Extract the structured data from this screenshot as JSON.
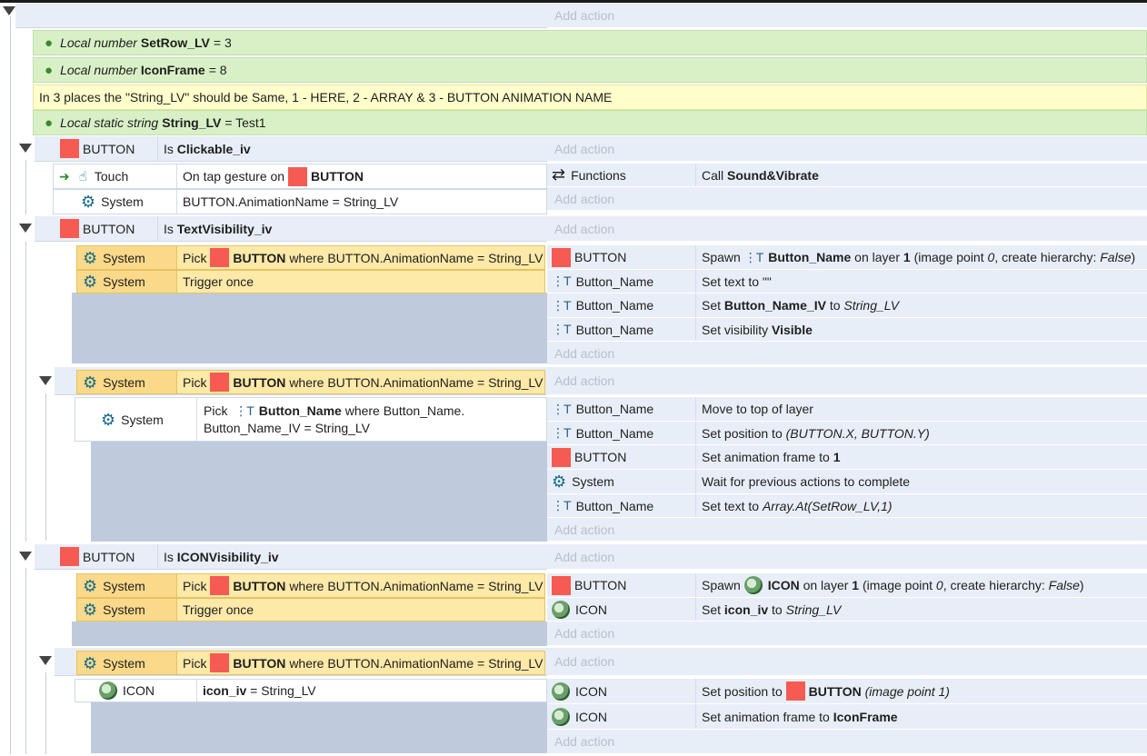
{
  "add_action": "Add action",
  "icons": {
    "tree_toggle": "expanded-triangle-icon",
    "variable": "map-pin-icon",
    "system": "gear-icon",
    "touch": "touch-hand-icon",
    "functions": "swap-arrows-icon",
    "text_object": "text-object-icon",
    "sprite": "red-square-sprite-icon",
    "icon_object": "icon-sprite-image"
  },
  "colors": {
    "variable_bg": "#d9f0c7",
    "comment_bg": "#ffffcc",
    "selected_bg": "#fde9a8",
    "sprite_red": "#f55b52",
    "block_bg": "#e8eef7",
    "panel_bg": "#bfcbdd"
  },
  "variables": [
    {
      "kind": "Local number",
      "name": "SetRow_LV",
      "eq": "= 3"
    },
    {
      "kind": "Local number",
      "name": "IconFrame",
      "eq": "= 8"
    },
    {
      "kind": "Local static string",
      "name": "String_LV",
      "eq": "= Test1"
    }
  ],
  "comment": "In 3 places the \"String_LV\" should be Same, 1 - HERE, 2 - ARRAY & 3 - BUTTON ANIMATION NAME",
  "g1": {
    "obj": "BUTTON",
    "cond_pre": "Is",
    "cond_bold": "Clickable_iv",
    "touch": {
      "obj": "Touch",
      "pre": "On tap gesture on",
      "target": "BUTTON"
    },
    "system": {
      "obj": "System",
      "text": "BUTTON.AnimationName = String_LV"
    },
    "action": {
      "obj": "Functions",
      "pre": "Call",
      "bold": "Sound&Vibrate"
    }
  },
  "g2": {
    "obj": "BUTTON",
    "cond_pre": "Is",
    "cond_bold": "TextVisibility_iv",
    "pick": {
      "obj": "System",
      "pre": "Pick",
      "target": "BUTTON",
      "rest": "where BUTTON.AnimationName = String_LV"
    },
    "trigger": {
      "obj": "System",
      "text": "Trigger once"
    },
    "actions": [
      {
        "obj": "BUTTON",
        "pre": "Spawn",
        "bold1": "Button_Name",
        "mid": "on layer",
        "bold2": "1",
        "p1": "(image point",
        "i1": "0",
        "p2": ", create hierarchy:",
        "i2": "False",
        "p3": ")"
      },
      {
        "obj": "Button_Name",
        "text": "Set text to \"\""
      },
      {
        "obj": "Button_Name",
        "pre": "Set",
        "bold": "Button_Name_IV",
        "mid": "to",
        "ital": "String_LV"
      },
      {
        "obj": "Button_Name",
        "pre": "Set visibility",
        "bold": "Visible"
      }
    ]
  },
  "g3": {
    "pick": {
      "obj": "System",
      "pre": "Pick",
      "target": "BUTTON",
      "rest": "where BUTTON.AnimationName = String_LV"
    },
    "sub": {
      "obj": "System",
      "pre": "Pick",
      "bold": "Button_Name",
      "rest": "where Button_Name.",
      "line2": "Button_Name_IV = String_LV"
    },
    "actions": [
      {
        "obj": "Button_Name",
        "text": "Move to top of layer"
      },
      {
        "obj": "Button_Name",
        "pre": "Set position to",
        "ital": "(BUTTON.X, BUTTON.Y)"
      },
      {
        "obj": "BUTTON",
        "pre": "Set animation frame to",
        "bold": "1"
      },
      {
        "obj": "System",
        "text": "Wait for previous actions to complete"
      },
      {
        "obj": "Button_Name",
        "pre": "Set text to",
        "ital": "Array.At(SetRow_LV,1)"
      }
    ]
  },
  "g4": {
    "obj": "BUTTON",
    "cond_pre": "Is",
    "cond_bold": "ICONVisibility_iv",
    "pick": {
      "obj": "System",
      "pre": "Pick",
      "target": "BUTTON",
      "rest": "where BUTTON.AnimationName = String_LV"
    },
    "trigger": {
      "obj": "System",
      "text": "Trigger once"
    },
    "actions": [
      {
        "obj": "BUTTON",
        "pre": "Spawn",
        "bold1": "ICON",
        "mid": "on layer",
        "bold2": "1",
        "p1": "(image point",
        "i1": "0",
        "p2": ", create hierarchy:",
        "i2": "False",
        "p3": ")"
      },
      {
        "obj": "ICON",
        "pre": "Set",
        "bold": "icon_iv",
        "mid": "to",
        "ital": "String_LV"
      }
    ]
  },
  "g5": {
    "pick": {
      "obj": "System",
      "pre": "Pick",
      "target": "BUTTON",
      "rest": "where BUTTON.AnimationName = String_LV"
    },
    "sub": {
      "obj": "ICON",
      "bold": "icon_iv",
      "rest": "= String_LV"
    },
    "actions": [
      {
        "obj": "ICON",
        "pre": "Set position to",
        "target": "BUTTON",
        "ital": "(image point 1)"
      },
      {
        "obj": "ICON",
        "pre": "Set animation frame to",
        "bold": "IconFrame"
      }
    ]
  }
}
